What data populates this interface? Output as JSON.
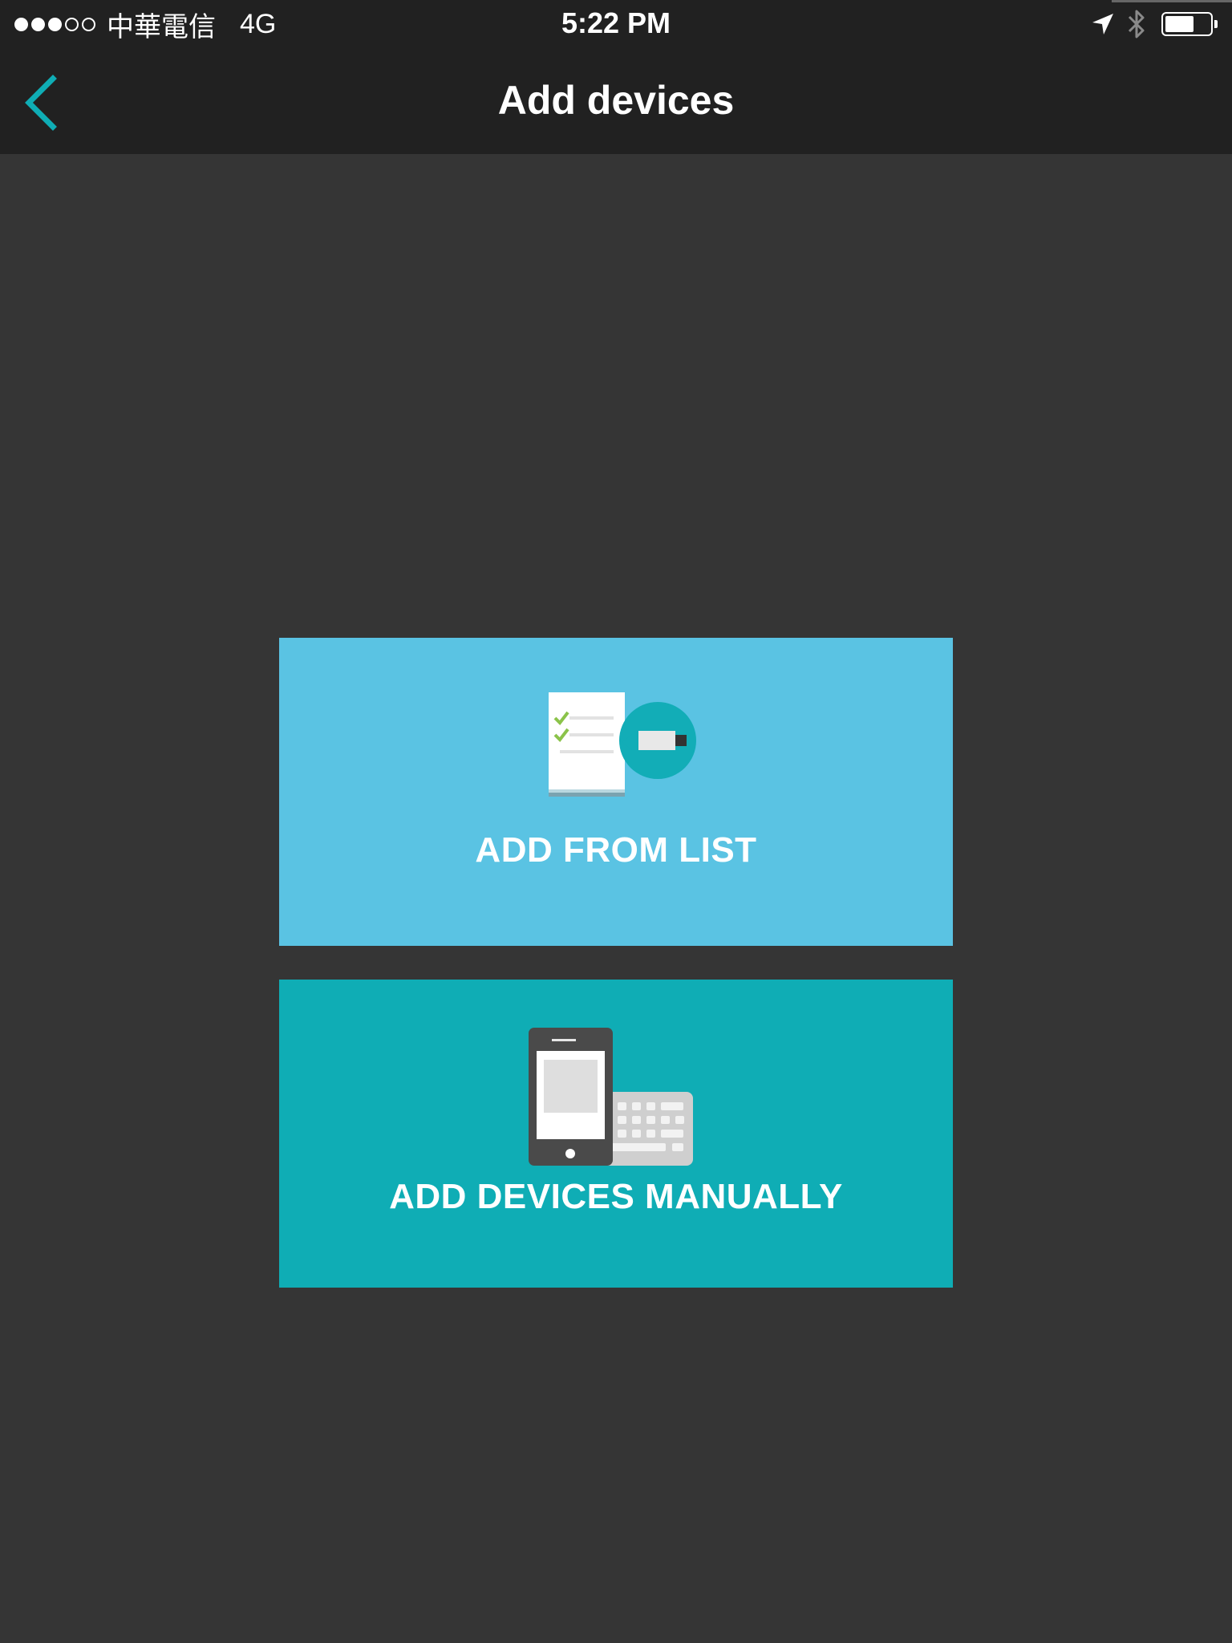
{
  "status_bar": {
    "signal": "●●●○○",
    "carrier": "中華電信",
    "network": "4G",
    "time": "5:22 PM",
    "icons": [
      "location-arrow-icon",
      "bluetooth-icon",
      "battery-icon"
    ],
    "battery_level_percent": 65
  },
  "nav": {
    "back_icon": "chevron-left-icon",
    "title": "Add devices"
  },
  "options": {
    "list": {
      "label": "ADD FROM LIST",
      "icon": "checklist-device-icon",
      "color": "#5ac3e3"
    },
    "manual": {
      "label": "ADD DEVICES MANUALLY",
      "icon": "phone-keyboard-icon",
      "color": "#0fadb5"
    }
  },
  "colors": {
    "accent": "#0fadb5",
    "background": "#353535",
    "header": "#212121"
  }
}
